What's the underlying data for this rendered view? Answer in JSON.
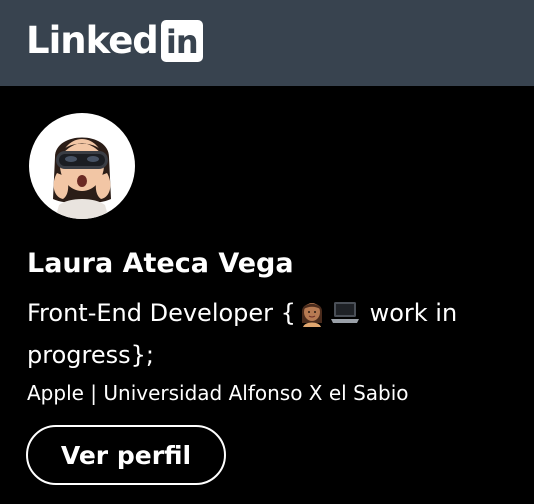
{
  "brand": {
    "logo_word": "Linked",
    "logo_box": "in"
  },
  "profile": {
    "avatar_icon": "memoji-avatar-icon",
    "name": "Laura Ateca Vega",
    "headline_before": "Front-End Developer {",
    "headline_after": " work in progress};",
    "headline_emojis": [
      "woman-emoji-icon",
      "laptop-emoji-icon"
    ],
    "organization": "Apple | Universidad Alfonso X el Sabio"
  },
  "actions": {
    "view_profile_label": "Ver perfil"
  },
  "colors": {
    "header_bg": "#38434f",
    "card_bg": "#000000",
    "text": "#ffffff"
  }
}
